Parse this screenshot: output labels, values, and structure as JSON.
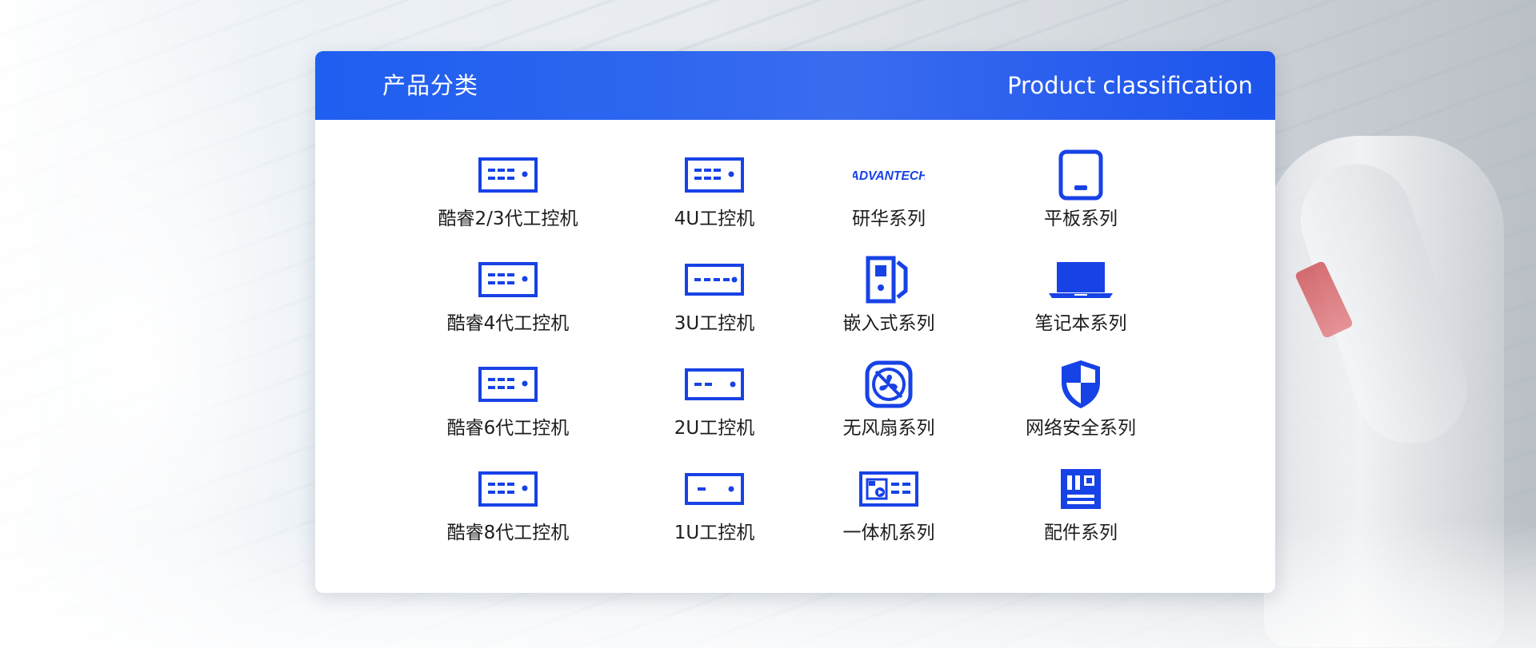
{
  "header": {
    "title_cn": "产品分类",
    "title_en": "Product classification"
  },
  "colors": {
    "accent": "#1742e6",
    "header": "#2c60ee",
    "text": "#1d1d1d"
  },
  "categories": [
    {
      "label": "酷睿2/3代工控机",
      "icon": "server-4dot-icon"
    },
    {
      "label": "4U工控机",
      "icon": "server-4dot-icon"
    },
    {
      "label": "研华系列",
      "icon": "advantech-logo",
      "logo_text": "ADVANTECH"
    },
    {
      "label": "平板系列",
      "icon": "tablet-icon"
    },
    {
      "label": "酷睿4代工控机",
      "icon": "server-4dot-icon"
    },
    {
      "label": "3U工控机",
      "icon": "server-3dash-icon"
    },
    {
      "label": "嵌入式系列",
      "icon": "embedded-box-icon"
    },
    {
      "label": "笔记本系列",
      "icon": "laptop-icon"
    },
    {
      "label": "酷睿6代工控机",
      "icon": "server-4dot-icon"
    },
    {
      "label": "2U工控机",
      "icon": "server-2dash-icon"
    },
    {
      "label": "无风扇系列",
      "icon": "fanless-icon"
    },
    {
      "label": "网络安全系列",
      "icon": "shield-icon"
    },
    {
      "label": "酷睿8代工控机",
      "icon": "server-4dot-icon"
    },
    {
      "label": "1U工控机",
      "icon": "server-1dash-icon"
    },
    {
      "label": "一体机系列",
      "icon": "all-in-one-icon"
    },
    {
      "label": "配件系列",
      "icon": "motherboard-icon"
    }
  ]
}
